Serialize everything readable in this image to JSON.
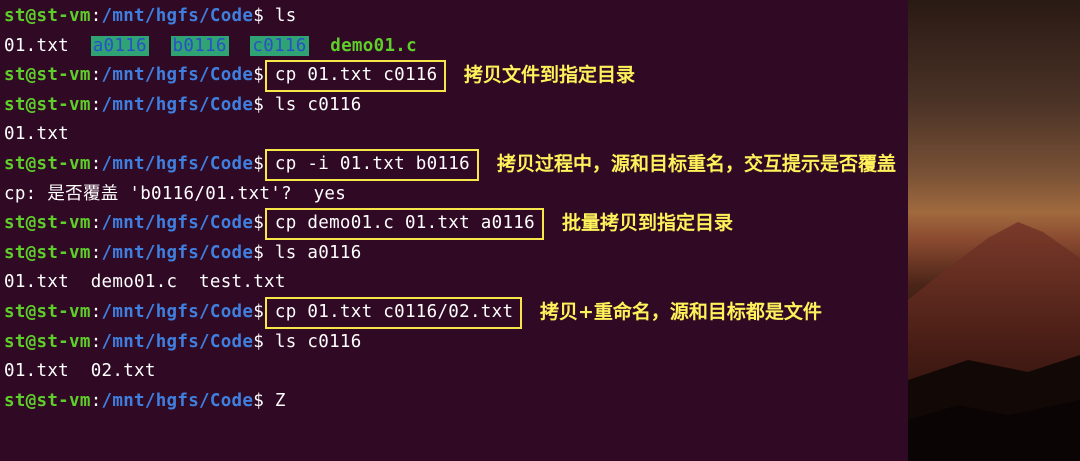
{
  "prompt": {
    "user": "st@st-vm",
    "sep": ":",
    "path": "/mnt/hgfs/Code",
    "sym": "$"
  },
  "lines": [
    {
      "kind": "prompt",
      "cmd": " ls"
    },
    {
      "kind": "listing",
      "items": [
        {
          "text": "01.txt",
          "style": "file"
        },
        {
          "text": "a0116",
          "style": "dir"
        },
        {
          "text": "b0116",
          "style": "dir"
        },
        {
          "text": "c0116",
          "style": "dir"
        },
        {
          "text": "demo01.c",
          "style": "cfile"
        }
      ]
    },
    {
      "kind": "prompt",
      "cmd": " cp 01.txt c0116"
    },
    {
      "kind": "prompt",
      "cmd": " ls c0116"
    },
    {
      "kind": "output",
      "text": "01.txt"
    },
    {
      "kind": "prompt",
      "cmd": " cp -i 01.txt b0116"
    },
    {
      "kind": "output",
      "text": "cp: 是否覆盖 'b0116/01.txt'?  yes"
    },
    {
      "kind": "prompt",
      "cmd": " cp demo01.c 01.txt a0116"
    },
    {
      "kind": "prompt",
      "cmd": " ls a0116"
    },
    {
      "kind": "listing",
      "items": [
        {
          "text": "01.txt",
          "style": "file"
        },
        {
          "text": "demo01.c",
          "style": "file"
        },
        {
          "text": "test.txt",
          "style": "file"
        }
      ]
    },
    {
      "kind": "prompt",
      "cmd": " cp 01.txt c0116/02.txt"
    },
    {
      "kind": "prompt",
      "cmd": " ls c0116"
    },
    {
      "kind": "listing",
      "items": [
        {
          "text": "01.txt",
          "style": "file"
        },
        {
          "text": "02.txt",
          "style": "file"
        }
      ]
    },
    {
      "kind": "prompt",
      "cmd": " Z"
    }
  ],
  "annotations": [
    {
      "line": 2,
      "text": "拷贝文件到指定目录"
    },
    {
      "line": 5,
      "text": "拷贝过程中，源和目标重名，交互提示是否覆盖"
    },
    {
      "line": 7,
      "text": "批量拷贝到指定目录"
    },
    {
      "line": 10,
      "text": "拷贝+重命名，源和目标都是文件"
    }
  ],
  "colors": {
    "background": "#300a24",
    "prompt_user": "#5ecf2a",
    "prompt_path": "#3f7fe0",
    "highlight": "#f7e64a",
    "annotation": "#fff15a",
    "dir_bg": "#2fa374"
  }
}
